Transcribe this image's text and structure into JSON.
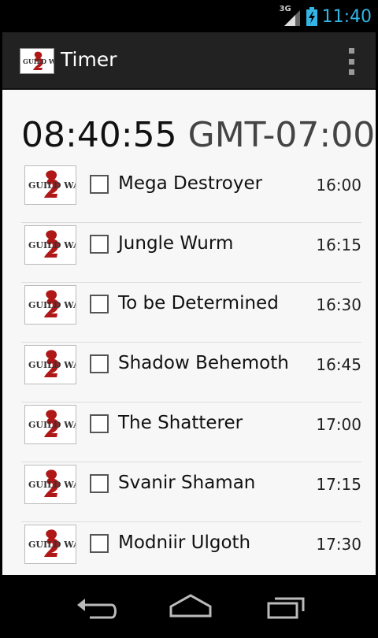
{
  "status_bar": {
    "network": "3G",
    "clock": "11:40",
    "icons": [
      "signal-icon",
      "battery-charging-icon"
    ],
    "accent_color": "#33b5e5"
  },
  "action_bar": {
    "app_icon": "guild-wars-logo",
    "title": "Timer",
    "menu_icon": "overflow-menu-icon"
  },
  "current_time": {
    "time": "08:40:55",
    "timezone": "GMT-07:00"
  },
  "events": [
    {
      "name": "Mega Destroyer",
      "time": "16:00",
      "checked": false
    },
    {
      "name": "Jungle Wurm",
      "time": "16:15",
      "checked": false
    },
    {
      "name": "To be Determined",
      "time": "16:30",
      "checked": false
    },
    {
      "name": "Shadow Behemoth",
      "time": "16:45",
      "checked": false
    },
    {
      "name": "The Shatterer",
      "time": "17:00",
      "checked": false
    },
    {
      "name": "Svanir Shaman",
      "time": "17:15",
      "checked": false
    },
    {
      "name": "Modniir Ulgoth",
      "time": "17:30",
      "checked": false
    }
  ],
  "nav_bar": {
    "buttons": [
      "back-icon",
      "home-icon",
      "recent-apps-icon"
    ]
  }
}
